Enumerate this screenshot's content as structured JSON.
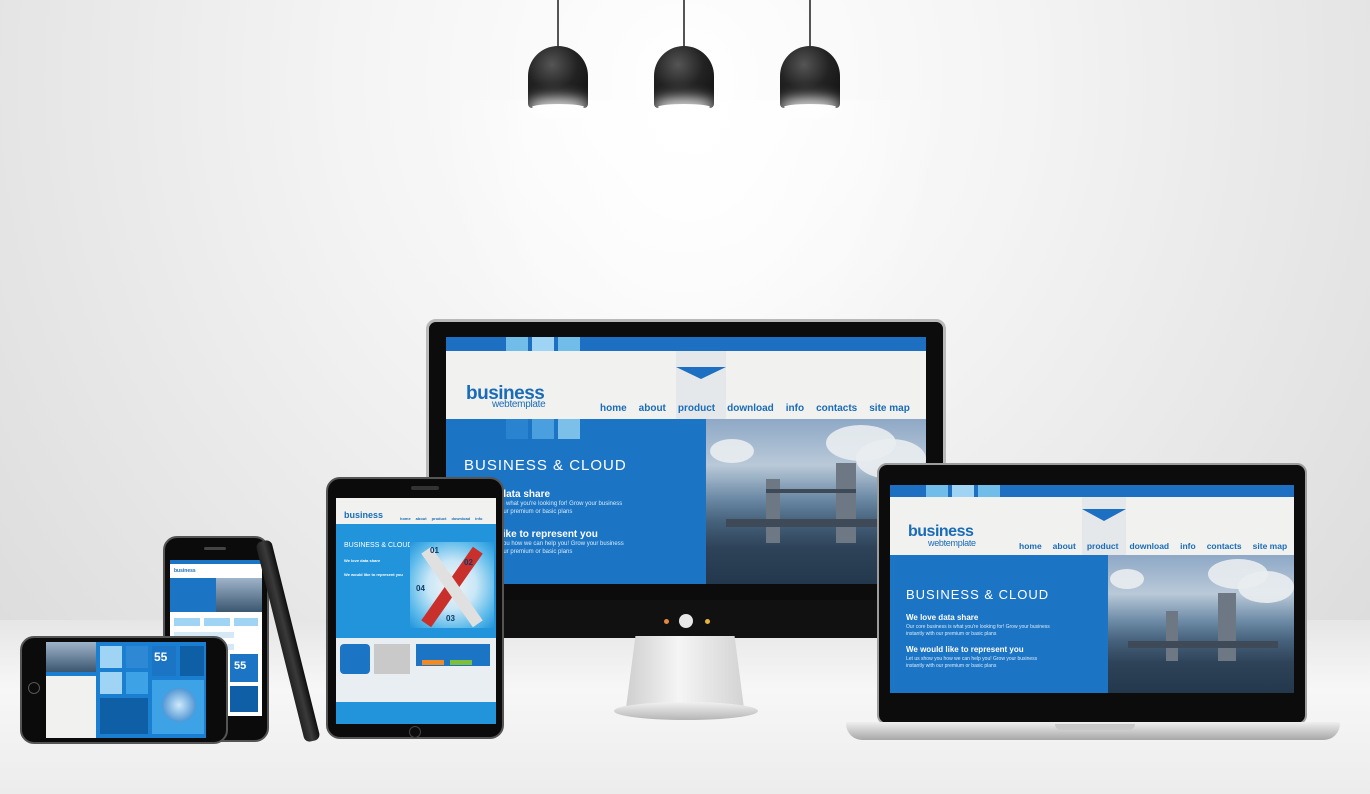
{
  "site": {
    "logo_main": "business",
    "logo_sub": "webtemplate",
    "nav": [
      "home",
      "about",
      "product",
      "download",
      "info",
      "contacts",
      "site map"
    ],
    "hero_title": "BUSINESS & CLOUD",
    "block1_heading": "We love data share",
    "block1_heading_cropped": "data share",
    "block1_text_1": "Our core business is what you're looking for! Grow your business",
    "block1_text_1_cropped": "is what you're looking for! Grow your business",
    "block1_text_2": "instantly with our premium or basic plans",
    "block1_text_2_cropped": "our premium or basic plans",
    "block2_heading": "We would like to represent you",
    "block2_heading_cropped": "like to represent you",
    "block2_text_1": "Let us show you how we can help you! Grow your business",
    "block2_text_1_cropped": "you how we can help you! Grow your business",
    "block2_text_2": "instantly with our premium or basic plans",
    "block2_text_2_cropped": "our premium or basic plans"
  },
  "mobile": {
    "tile_number": "55",
    "numbers": [
      "01",
      "02",
      "03",
      "04"
    ]
  },
  "colors": {
    "brand_blue": "#1c74c4",
    "accent_light_blue": "#6fbde8",
    "background": "#f1f1ef"
  }
}
